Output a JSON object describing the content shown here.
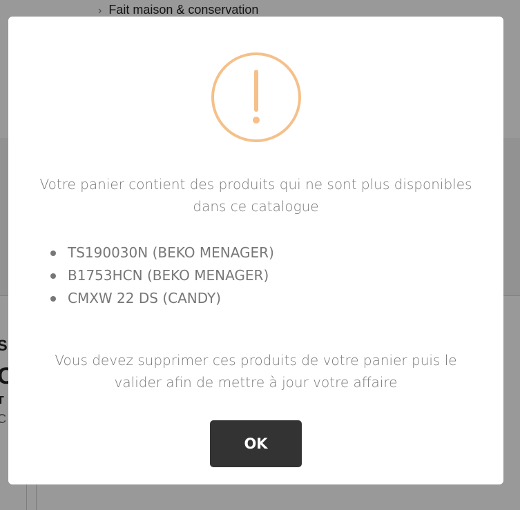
{
  "background": {
    "menu_item": "Fait maison & conservation",
    "side_fragments": [
      "S",
      "C",
      "T",
      "C"
    ]
  },
  "dialog": {
    "icon": "exclamation-circle-icon",
    "icon_color": "#f5c08a",
    "message_top": "Votre panier contient des produits qui ne sont plus disponibles dans ce catalogue",
    "products": [
      "TS190030N (BEKO MENAGER)",
      "B1753HCN (BEKO MENAGER)",
      "CMXW 22 DS (CANDY)"
    ],
    "message_bottom": "Vous devez supprimer ces produits de votre panier puis le valider afin de mettre à jour votre affaire",
    "ok_label": "OK",
    "ok_color": "#333333"
  }
}
